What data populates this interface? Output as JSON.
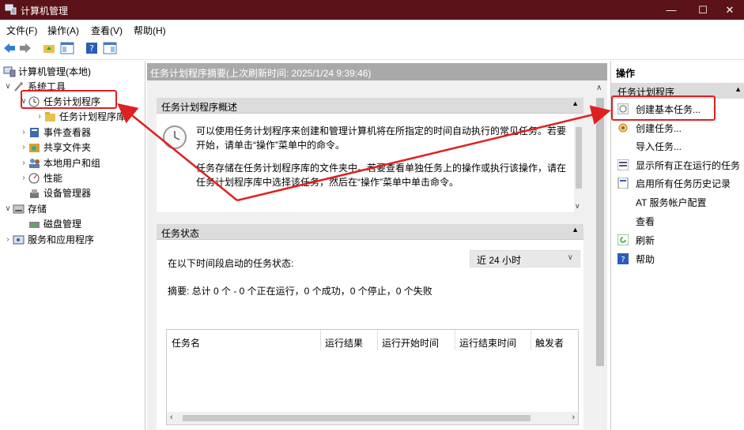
{
  "window": {
    "title": "计算机管理",
    "controls": {
      "minimize": "—",
      "maximize": "☐",
      "close": "✕"
    }
  },
  "menu": {
    "items": [
      "文件(F)",
      "操作(A)",
      "查看(V)",
      "帮助(H)"
    ]
  },
  "tree": {
    "root": "计算机管理(本地)",
    "items": [
      {
        "label": "系统工具"
      },
      {
        "label": "任务计划程序"
      },
      {
        "label": "任务计划程序库"
      },
      {
        "label": "事件查看器"
      },
      {
        "label": "共享文件夹"
      },
      {
        "label": "本地用户和组"
      },
      {
        "label": "性能"
      },
      {
        "label": "设备管理器"
      },
      {
        "label": "存储"
      },
      {
        "label": "磁盘管理"
      },
      {
        "label": "服务和应用程序"
      }
    ]
  },
  "main": {
    "header": "任务计划程序摘要(上次刷新时间: 2025/1/24 9:39:46)",
    "overview": {
      "title": "任务计划程序概述",
      "para1_line1": "可以使用任务计划程序来创建和管理计算机将在所指定的时间自动执行的常见任务。若要",
      "para1_line2": "开始，请单击“操作”菜单中的命令。",
      "para2_line1": "任务存储在任务计划程序库的文件夹中。若要查看单独任务上的操作或执行该操作，请在",
      "para2_line2": "任务计划程序库中选择该任务，然后在“操作”菜单中单击命令。"
    },
    "status": {
      "title": "任务状态",
      "label": "在以下时间段启动的任务状态:",
      "range_value": "近 24 小时",
      "summary": "摘要: 总计 0 个 - 0 个正在运行，0 个成功，0 个停止，0 个失败",
      "columns": [
        "任务名",
        "运行结果",
        "运行开始时间",
        "运行结束时间",
        "触发者"
      ]
    }
  },
  "actions": {
    "title": "操作",
    "group": "任务计划程序",
    "items": [
      {
        "label": "创建基本任务...",
        "icon": "create-basic-task-icon"
      },
      {
        "label": "创建任务...",
        "icon": "create-task-icon"
      },
      {
        "label": "导入任务...",
        "icon": ""
      },
      {
        "label": "显示所有正在运行的任务",
        "icon": "running-tasks-icon"
      },
      {
        "label": "启用所有任务历史记录",
        "icon": "history-icon"
      },
      {
        "label": "AT 服务帐户配置",
        "icon": ""
      },
      {
        "label": "查看",
        "icon": ""
      },
      {
        "label": "刷新",
        "icon": "refresh-icon"
      },
      {
        "label": "帮助",
        "icon": "help-icon"
      }
    ]
  },
  "colors": {
    "titlebar": "#5b1218",
    "highlight_box": "#e02020",
    "annotation_arrow": "#e02020"
  }
}
